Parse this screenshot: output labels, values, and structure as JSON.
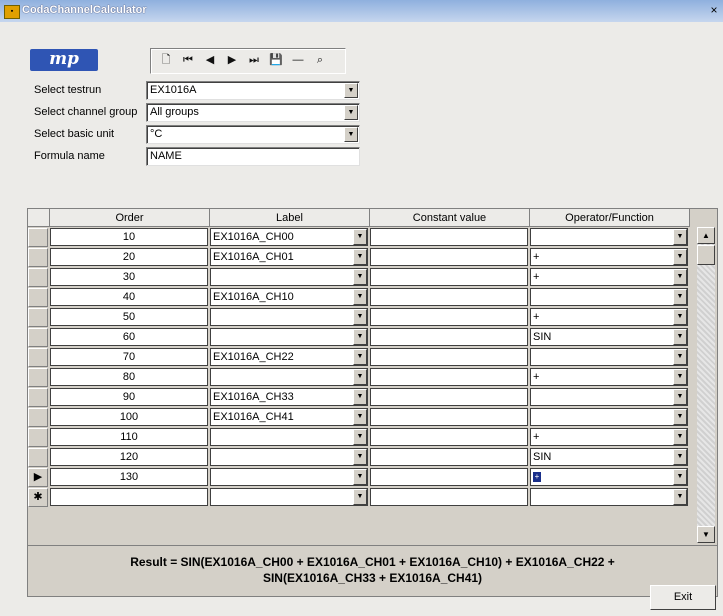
{
  "window": {
    "title": "CodaChannelCalculator",
    "close": "×"
  },
  "logo": {
    "text": "mp"
  },
  "toolbar": {
    "buttons": [
      "new-icon",
      "first-icon",
      "prev-icon",
      "next-icon",
      "last-icon",
      "save-icon",
      "delete-icon",
      "find-icon"
    ]
  },
  "form": {
    "testrun_label": "Select testrun",
    "testrun_value": "EX1016A",
    "group_label": "Select channel group",
    "group_value": "All groups",
    "unit_label": "Select basic unit",
    "unit_value": "°C",
    "formula_label": "Formula name",
    "formula_value": "NAME"
  },
  "grid": {
    "columns": [
      "Order",
      "Label",
      "Constant value",
      "Operator/Function"
    ],
    "rows": [
      {
        "order": "10",
        "label": "EX1016A_CH00",
        "constant": "",
        "op": ""
      },
      {
        "order": "20",
        "label": "EX1016A_CH01",
        "constant": "",
        "op": "+"
      },
      {
        "order": "30",
        "label": "",
        "constant": "",
        "op": "+"
      },
      {
        "order": "40",
        "label": "EX1016A_CH10",
        "constant": "",
        "op": ""
      },
      {
        "order": "50",
        "label": "",
        "constant": "",
        "op": "+"
      },
      {
        "order": "60",
        "label": "",
        "constant": "",
        "op": "SIN"
      },
      {
        "order": "70",
        "label": "EX1016A_CH22",
        "constant": "",
        "op": ""
      },
      {
        "order": "80",
        "label": "",
        "constant": "",
        "op": "+"
      },
      {
        "order": "90",
        "label": "EX1016A_CH33",
        "constant": "",
        "op": ""
      },
      {
        "order": "100",
        "label": "EX1016A_CH41",
        "constant": "",
        "op": ""
      },
      {
        "order": "110",
        "label": "",
        "constant": "",
        "op": "+"
      },
      {
        "order": "120",
        "label": "",
        "constant": "",
        "op": "SIN"
      },
      {
        "order": "130",
        "label": "",
        "constant": "",
        "op": "+"
      },
      {
        "order": "",
        "label": "",
        "constant": "",
        "op": ""
      }
    ],
    "current_marker": "▶",
    "new_marker": "✱"
  },
  "result": {
    "line1": "Result = SIN(EX1016A_CH00  + EX1016A_CH01  + EX1016A_CH10)  + EX1016A_CH22  +",
    "line2": "SIN(EX1016A_CH33  + EX1016A_CH41)"
  },
  "buttons": {
    "exit": "Exit"
  }
}
